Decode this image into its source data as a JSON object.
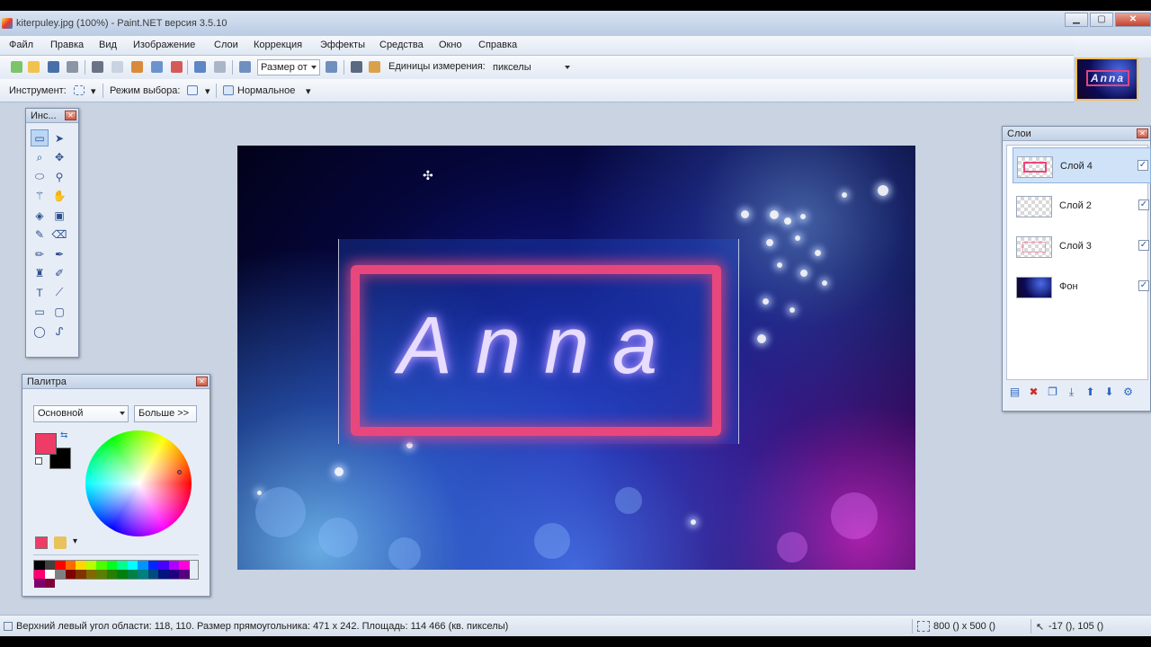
{
  "window": {
    "title": "kiterpuley.jpg (100%) - Paint.NET версия 3.5.10",
    "minimize": "▁",
    "maximize": "▢",
    "close": "✕"
  },
  "menu": [
    "Файл",
    "Правка",
    "Вид",
    "Изображение",
    "Слои",
    "Коррекция",
    "Эффекты",
    "Средства",
    "Окно",
    "Справка"
  ],
  "toolbar": {
    "zoom_select": "Размер от",
    "units_label": "Единицы измерения:",
    "units_value": "пикселы"
  },
  "toolbar2": {
    "tool_label": "Инструмент:",
    "selection_mode_label": "Режим выбора:",
    "blend_mode": "Нормальное"
  },
  "image_tab": {
    "thumb_text": "Anna"
  },
  "canvas": {
    "text": "Anna",
    "cursor": "✣"
  },
  "tools_window": {
    "title": "Инс...",
    "close": "✕"
  },
  "tools": [
    {
      "icon": "rectangle-select-icon",
      "glyph": "▭"
    },
    {
      "icon": "move-selection-icon",
      "glyph": "➤"
    },
    {
      "icon": "lasso-select-icon",
      "glyph": "⌕"
    },
    {
      "icon": "move-selected-icon",
      "glyph": "✥"
    },
    {
      "icon": "ellipse-select-icon",
      "glyph": "⬭"
    },
    {
      "icon": "zoom-icon",
      "glyph": "⚲"
    },
    {
      "icon": "magic-wand-icon",
      "glyph": "⚚"
    },
    {
      "icon": "pan-icon",
      "glyph": "✋"
    },
    {
      "icon": "paint-bucket-icon",
      "glyph": "◈"
    },
    {
      "icon": "gradient-icon",
      "glyph": "▣"
    },
    {
      "icon": "paintbrush-icon",
      "glyph": "✎"
    },
    {
      "icon": "eraser-icon",
      "glyph": "⌫"
    },
    {
      "icon": "pencil-icon",
      "glyph": "✏"
    },
    {
      "icon": "color-picker-icon",
      "glyph": "✒"
    },
    {
      "icon": "clone-stamp-icon",
      "glyph": "♜"
    },
    {
      "icon": "recolor-icon",
      "glyph": "✐"
    },
    {
      "icon": "text-icon",
      "glyph": "T"
    },
    {
      "icon": "line-curve-icon",
      "glyph": "⟋"
    },
    {
      "icon": "rectangle-icon",
      "glyph": "▭"
    },
    {
      "icon": "rounded-rectangle-icon",
      "glyph": "▢"
    },
    {
      "icon": "ellipse-icon",
      "glyph": "◯"
    },
    {
      "icon": "freeform-shape-icon",
      "glyph": "ᔑ"
    }
  ],
  "palette": {
    "title": "Палитра",
    "close": "✕",
    "mode": "Основной",
    "more_button": "Больше >>",
    "primary_color": "#ee3c67",
    "secondary_color": "#000000",
    "swatches": [
      "#000000",
      "#404040",
      "#ff0000",
      "#ff6a00",
      "#ffd800",
      "#b6ff00",
      "#4cff00",
      "#00ff21",
      "#00ff90",
      "#00ffff",
      "#0094ff",
      "#0026ff",
      "#4800ff",
      "#b200ff",
      "#ff00dc",
      "#ff006e",
      "#ffffff",
      "#808080",
      "#7f0000",
      "#7f3300",
      "#7f6a00",
      "#5b7f00",
      "#267f00",
      "#007f0e",
      "#007f46",
      "#007f7f",
      "#004a7f",
      "#00137f",
      "#21007f",
      "#57007f",
      "#7f006e",
      "#7f0037"
    ]
  },
  "layers": {
    "title": "Слои",
    "close": "✕",
    "items": [
      {
        "name": "Слой 4",
        "selected": true,
        "check": "✓"
      },
      {
        "name": "Слой 2",
        "selected": false,
        "check": "✓"
      },
      {
        "name": "Слой 3",
        "selected": false,
        "check": "✓"
      },
      {
        "name": "Фон",
        "selected": false,
        "check": "✓"
      }
    ],
    "actions": [
      {
        "icon": "add-layer-icon",
        "glyph": "▤"
      },
      {
        "icon": "delete-layer-icon",
        "glyph": "✖"
      },
      {
        "icon": "duplicate-layer-icon",
        "glyph": "❐"
      },
      {
        "icon": "merge-layer-icon",
        "glyph": "⤓"
      },
      {
        "icon": "move-up-icon",
        "glyph": "⬆"
      },
      {
        "icon": "move-down-icon",
        "glyph": "⬇"
      },
      {
        "icon": "layer-properties-icon",
        "glyph": "⚙"
      }
    ]
  },
  "status": {
    "selection_info": "Верхний левый угол области: 118, 110. Размер прямоугольника: 471 x 242. Площадь: 114 466 (кв. пикселы)",
    "image_size": "800 () x 500 ()",
    "cursor_pos": "-17 (), 105 ()"
  }
}
